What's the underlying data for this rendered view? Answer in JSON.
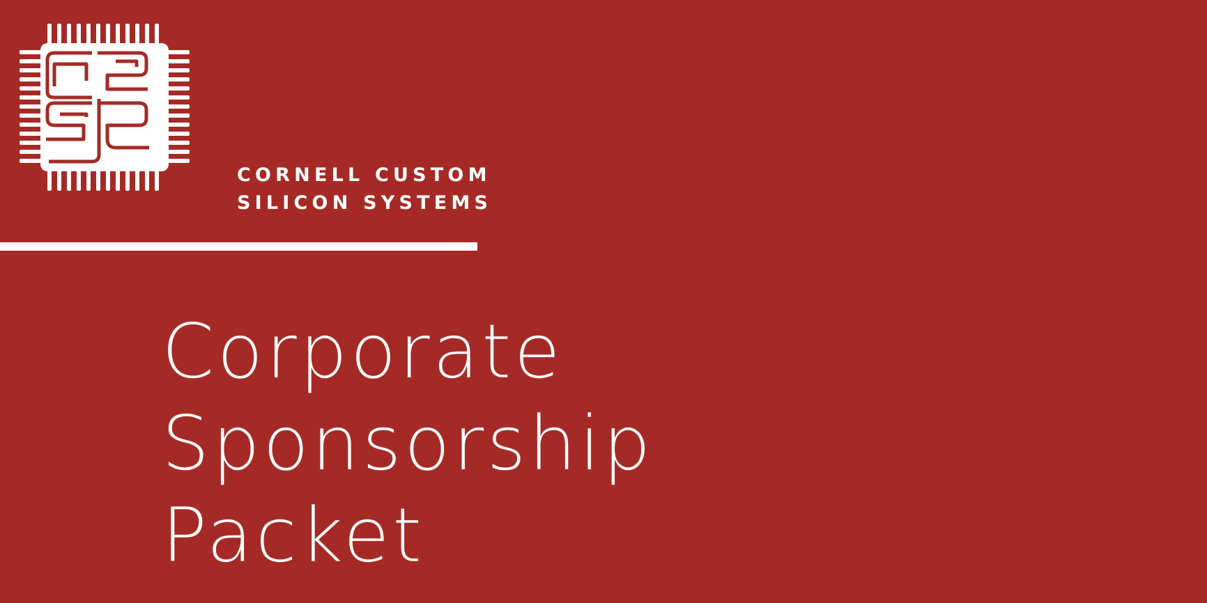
{
  "organization": {
    "line1": "CORNELL CUSTOM",
    "line2": "SILICON SYSTEMS"
  },
  "document": {
    "title_lines": [
      "Corporate",
      "Sponsorship",
      "Packet"
    ]
  },
  "colors": {
    "background": "#a52a25",
    "foreground": "#ffffff"
  },
  "logo": {
    "icon": "microchip-c2s2-icon"
  }
}
